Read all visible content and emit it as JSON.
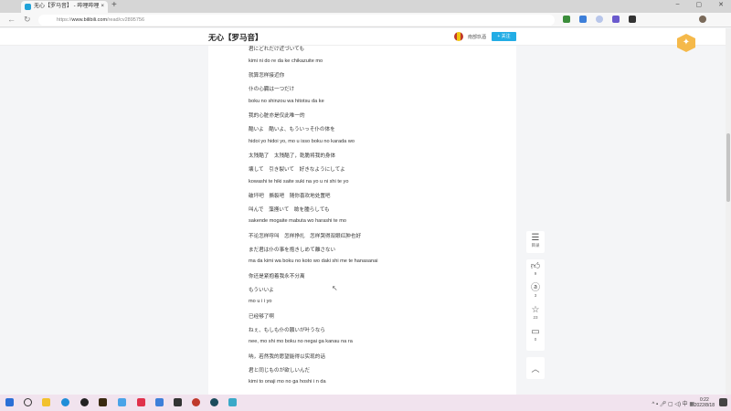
{
  "browser": {
    "tab_title": "无心【罗马音】 - 哔哩哔哩",
    "url_prefix": "https://",
    "url_domain": "www.bilibili.com",
    "url_path": "/read/cv2895756",
    "new_tab": "+",
    "close": "×",
    "minimize": "–",
    "maximize": "▢",
    "close_window": "✕",
    "back": "←",
    "refresh": "↻"
  },
  "header": {
    "title": "无心【罗马音】",
    "author": "南部玖酒",
    "follow_label": "+ 关注"
  },
  "lyrics": [
    "君にどれだけ近づいても",
    "kimi ni do re da ke chikazuite mo",
    "就算怎样接近你",
    "仆の心臓は一つだけ",
    "boku no shinzou wa hitotsu da ke",
    "我的心脏亦是仅此唯一的",
    "酷いよ　酷いよ、もういっそ仆の体を",
    "hidoi yo hidoi yo, mo u isso boku no karada wo",
    "太残酷了　太残酷了，乾脆将我的身体",
    "壊して　引き裂いて　好きなようにしてよ",
    "kowashi te hiki saite suki na yo u ni shi te yo",
    "破坏吧　撕裂吧　随你喜欢地处置吧",
    "叫んで　藻掻いて　瞼を腫らしても",
    "sakende mogaite mabuta wo harashi te mo",
    "不论怎样呼叫　怎样挣扎　怎样哭得双眼红肿也好",
    "まだ君は仆の事を抱きしめて離さない",
    "ma da kimi wa boku no koto wo daki shi me te hanasanai",
    "你还是紧抱着我永不分离",
    "もういいよ",
    "mo u i i yo",
    "已经够了啊",
    "ねぇ、もしも仆の願いが叶うなら",
    "nee, mo shi mo boku no negai ga kanau na ra",
    "呐，若然我的愿望能得以实现的话",
    "君と同じものが欲しいんだ",
    "kimi to onaji mo no ga hoshi i n da"
  ],
  "sidebar": {
    "toc": "目录",
    "likes": "9",
    "coins": "3",
    "favorites": "23",
    "comments": "0",
    "top": "︿"
  },
  "taskbar": {
    "time": "0:22",
    "date": "2022/8/18"
  }
}
